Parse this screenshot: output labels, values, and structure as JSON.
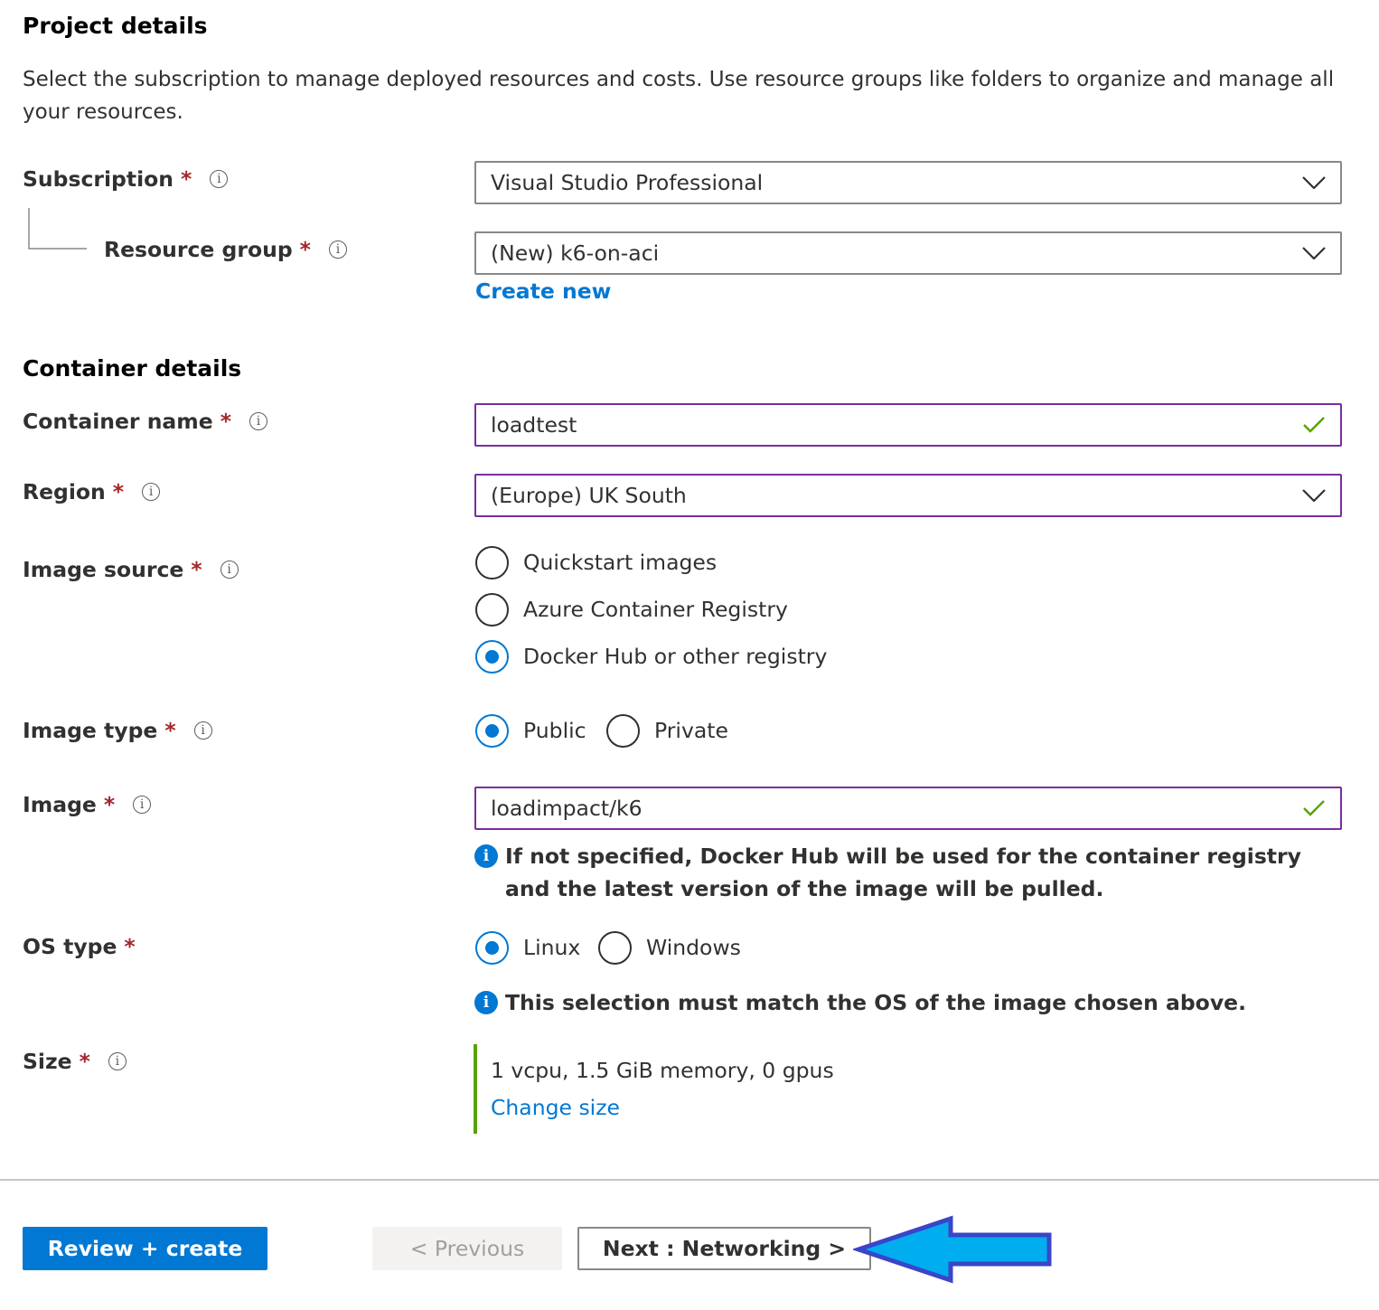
{
  "project": {
    "heading": "Project details",
    "description": "Select the subscription to manage deployed resources and costs. Use resource groups like folders to organize and manage all your resources.",
    "subscription": {
      "label": "Subscription",
      "required": "*",
      "value": "Visual Studio Professional"
    },
    "resource_group": {
      "label": "Resource group",
      "required": "*",
      "value": "(New) k6-on-aci",
      "create_new": "Create new"
    }
  },
  "container": {
    "heading": "Container details",
    "name": {
      "label": "Container name",
      "required": "*",
      "value": "loadtest"
    },
    "region": {
      "label": "Region",
      "required": "*",
      "value": "(Europe) UK South"
    },
    "image_source": {
      "label": "Image source",
      "required": "*",
      "options": [
        "Quickstart images",
        "Azure Container Registry",
        "Docker Hub or other registry"
      ],
      "selected": "Docker Hub or other registry"
    },
    "image_type": {
      "label": "Image type",
      "required": "*",
      "options": [
        "Public",
        "Private"
      ],
      "selected": "Public"
    },
    "image": {
      "label": "Image",
      "required": "*",
      "value": "loadimpact/k6",
      "info": "If not specified, Docker Hub will be used for the container registry and the latest version of the image will be pulled."
    },
    "os_type": {
      "label": "OS type",
      "required": "*",
      "options": [
        "Linux",
        "Windows"
      ],
      "selected": "Linux",
      "info": "This selection must match the OS of the image chosen above."
    },
    "size": {
      "label": "Size",
      "required": "*",
      "value": "1 vcpu, 1.5 GiB memory, 0 gpus",
      "change": "Change size"
    }
  },
  "footer": {
    "review_create": "Review + create",
    "previous": "< Previous",
    "next": "Next : Networking >"
  },
  "icons": {
    "info_outline": "i",
    "info_filled": "i"
  },
  "colors": {
    "accent": "#0078d4",
    "required": "#a4262c",
    "focus_border": "#7a2e9e",
    "valid": "#57a300",
    "arrow_fill": "#00aef0",
    "arrow_stroke": "#3a45c8"
  }
}
